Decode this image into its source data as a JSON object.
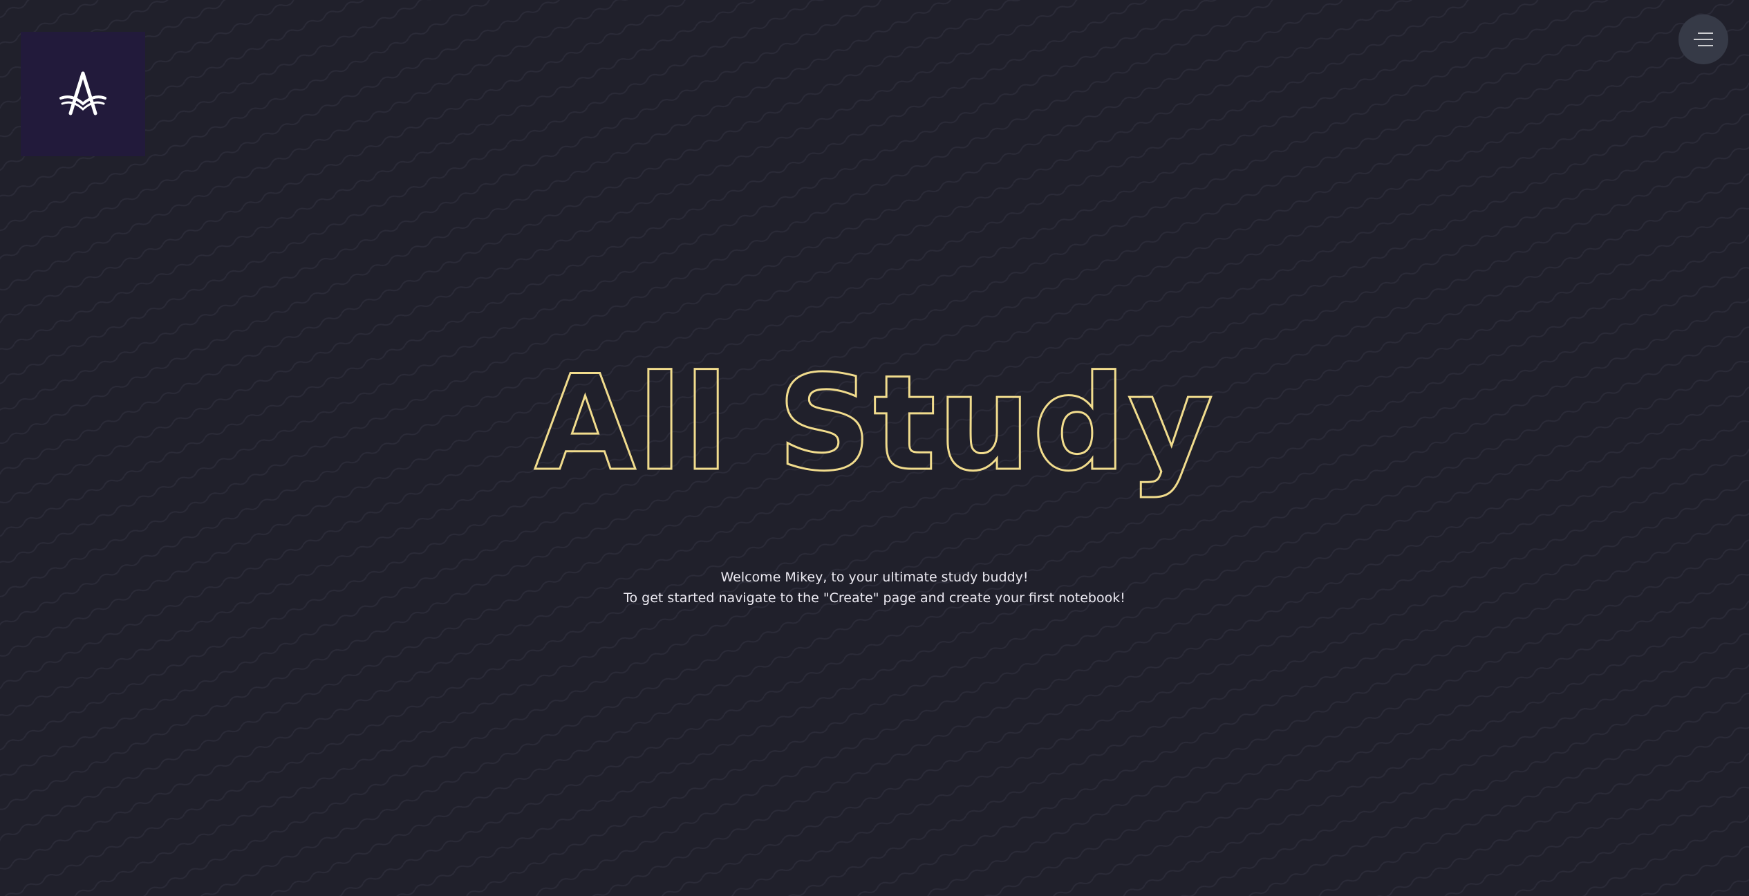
{
  "app": {
    "logo": {
      "icon": "all-study-logo-icon",
      "tile_color": "#221a3b"
    },
    "menu": {
      "icon": "hamburger-menu-icon"
    }
  },
  "hero": {
    "title": "All Study",
    "title_stroke_color": "#f1dc8d"
  },
  "welcome": {
    "line1": "Welcome Mikey, to your ultimate study buddy!",
    "line2": "To get started navigate to the \"Create\" page and create your first notebook!"
  },
  "colors": {
    "background": "#20202b",
    "text": "#eceaf2"
  }
}
